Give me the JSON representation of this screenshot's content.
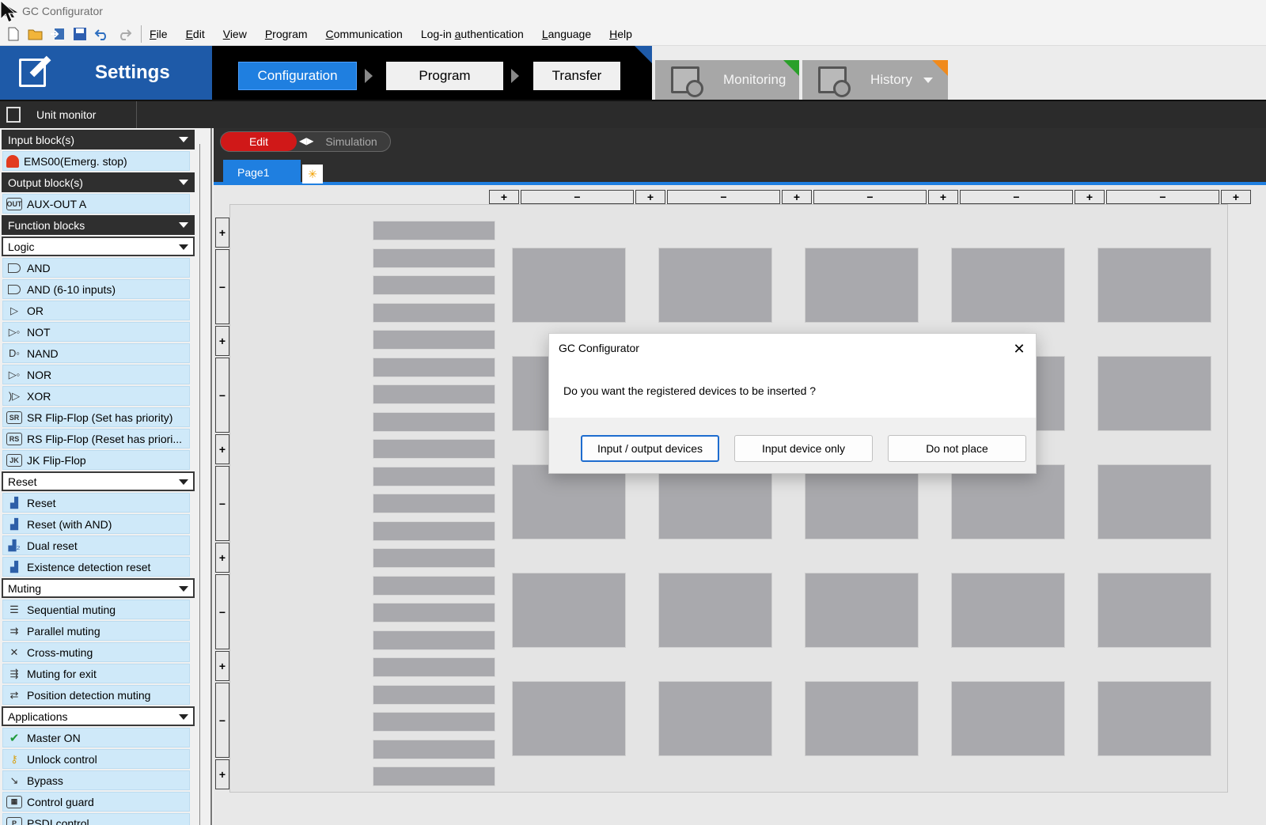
{
  "window": {
    "title": "GC Configurator"
  },
  "menu": {
    "items": [
      {
        "label": "File",
        "u": "F",
        "rest": "ile"
      },
      {
        "label": "Edit",
        "u": "E",
        "rest": "dit"
      },
      {
        "label": "View",
        "u": "V",
        "rest": "iew"
      },
      {
        "label": "Program",
        "u": "P",
        "rest": "rogram"
      },
      {
        "label": "Communication",
        "u": "C",
        "rest": "ommunication"
      },
      {
        "label": "Log-in authentication",
        "pre": "Log-in ",
        "u": "a",
        "rest": "uthentication"
      },
      {
        "label": "Language",
        "u": "L",
        "rest": "anguage"
      },
      {
        "label": "Help",
        "u": "H",
        "rest": "elp"
      }
    ]
  },
  "nav": {
    "settings_label": "Settings",
    "workflow": {
      "configuration": "Configuration",
      "program": "Program",
      "transfer": "Transfer"
    },
    "monitoring": "Monitoring",
    "history": "History",
    "colors": {
      "settings_bg": "#1e5aa8",
      "active_step": "#1f7fe0",
      "monitoring_tri": "#2aa02a",
      "history_tri": "#f08a1c"
    }
  },
  "unit_monitor": "Unit monitor",
  "left_panel": {
    "input_header": "Input block(s)",
    "input_items": [
      "EMS00(Emerg. stop)"
    ],
    "output_header": "Output block(s)",
    "output_items": [
      "AUX-OUT A"
    ],
    "function_header": "Function blocks",
    "logic_select": "Logic",
    "logic_items": [
      "AND",
      "AND (6-10 inputs)",
      "OR",
      "NOT",
      "NAND",
      "NOR",
      "XOR",
      "SR Flip-Flop (Set has priority)",
      "RS Flip-Flop (Reset has priori...",
      "JK Flip-Flop"
    ],
    "reset_select": "Reset",
    "reset_items": [
      "Reset",
      "Reset (with AND)",
      "Dual reset",
      "Existence detection reset"
    ],
    "muting_select": "Muting",
    "muting_items": [
      "Sequential muting",
      "Parallel muting",
      "Cross-muting",
      "Muting for exit",
      "Position detection muting"
    ],
    "applications_select": "Applications",
    "applications_items": [
      "Master ON",
      "Unlock control",
      "Bypass",
      "Control guard",
      "PSDI control"
    ]
  },
  "edit_area": {
    "mode_edit": "Edit",
    "mode_simulation": "Simulation",
    "page_tab": "Page1",
    "plus": "+",
    "minus": "−"
  },
  "dialog": {
    "title": "GC Configurator",
    "message": "Do you want the registered devices to be inserted ?",
    "buttons": {
      "io": "Input / output devices",
      "input_only": "Input device only",
      "do_not_place": "Do not place"
    }
  }
}
